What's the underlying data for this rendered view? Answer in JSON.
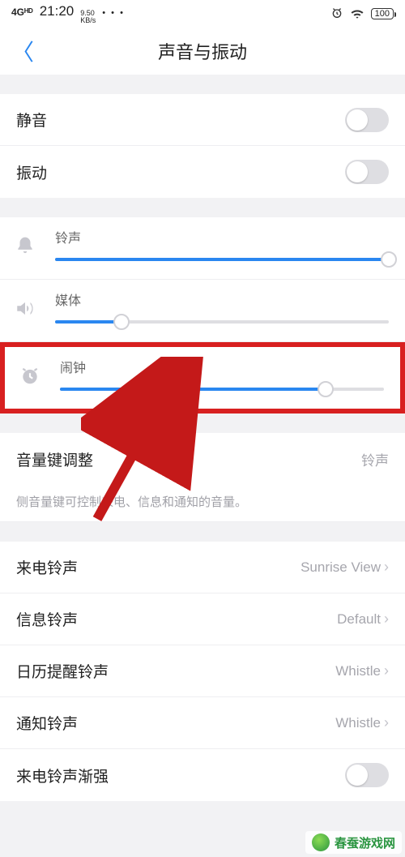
{
  "status": {
    "net": "4Gᴴᴰ",
    "signal": "📶",
    "time": "21:20",
    "speed_top": "9.50",
    "speed_bottom": "KB/s",
    "dots": "• • •",
    "alarm": "⏰",
    "wifi": "📶",
    "battery": "100"
  },
  "header": {
    "back_glyph": "〈",
    "title": "声音与振动"
  },
  "toggles": [
    {
      "name": "silent",
      "label": "静音",
      "on": false
    },
    {
      "name": "vibrate",
      "label": "振动",
      "on": false
    }
  ],
  "sliders": [
    {
      "name": "ringtone",
      "label": "铃声",
      "percent": 100,
      "icon": "bell"
    },
    {
      "name": "media",
      "label": "媒体",
      "percent": 20,
      "icon": "speaker"
    },
    {
      "name": "alarm",
      "label": "闹钟",
      "percent": 82,
      "icon": "clock",
      "highlighted": true
    }
  ],
  "volume_key": {
    "label": "音量键调整",
    "value": "铃声",
    "desc": "侧音量键可控制来电、信息和通知的音量。"
  },
  "items": [
    {
      "name": "ringtone-incoming",
      "label": "来电铃声",
      "value": "Sunrise View",
      "chevron": true
    },
    {
      "name": "ringtone-message",
      "label": "信息铃声",
      "value": "Default",
      "chevron": true
    },
    {
      "name": "ringtone-calendar",
      "label": "日历提醒铃声",
      "value": "Whistle",
      "chevron": true
    },
    {
      "name": "ringtone-notification",
      "label": "通知铃声",
      "value": "Whistle",
      "chevron": true
    }
  ],
  "bottom_toggle": {
    "name": "fadein",
    "label": "来电铃声渐强",
    "on": false
  },
  "watermark": "春蚕游戏网"
}
